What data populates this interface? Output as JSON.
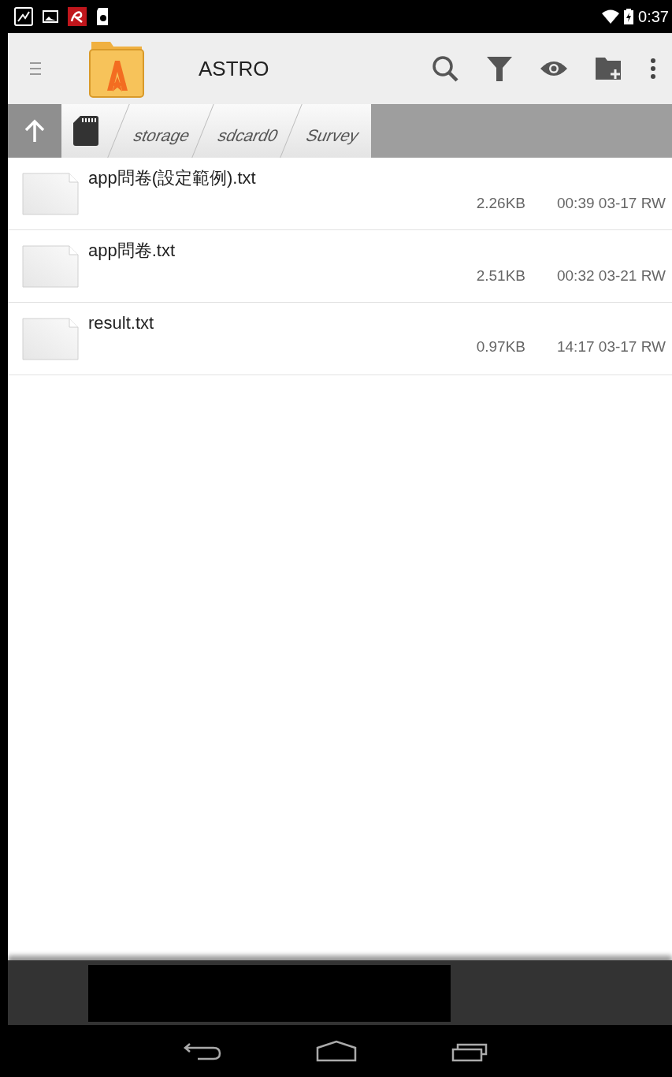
{
  "status_bar": {
    "time": "0:37"
  },
  "toolbar": {
    "title": "ASTRO"
  },
  "breadcrumbs": [
    "storage",
    "sdcard0",
    "Survey"
  ],
  "files": [
    {
      "name": "app問卷(設定範例).txt",
      "size": "2.26KB",
      "modified": "00:39 03-17 RW"
    },
    {
      "name": "app問卷.txt",
      "size": "2.51KB",
      "modified": "00:32 03-21 RW"
    },
    {
      "name": "result.txt",
      "size": "0.97KB",
      "modified": "14:17 03-17 RW"
    }
  ]
}
